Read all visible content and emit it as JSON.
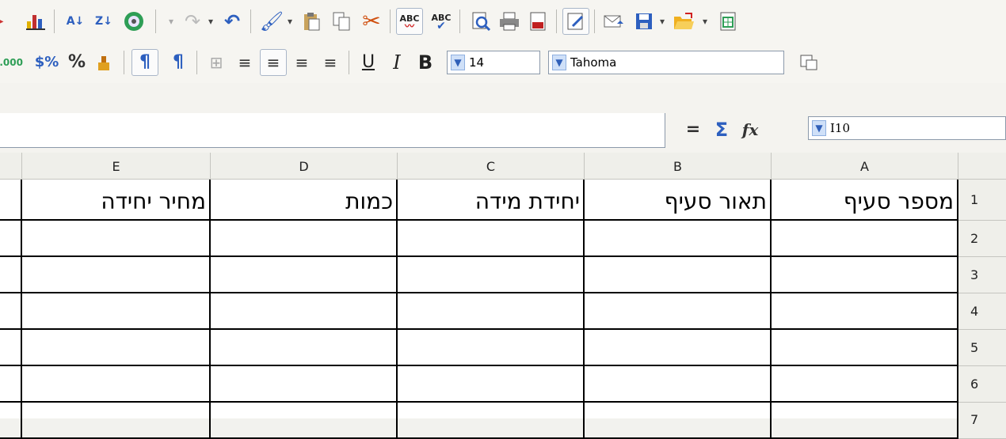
{
  "toolbar_standard": {
    "icons": [
      "chart-icon",
      "sort-ascending-icon",
      "sort-descending-icon",
      "navigator-icon",
      "redo-icon",
      "undo-icon",
      "format-paintbrush-icon",
      "paste-icon",
      "copy-icon",
      "cut-icon",
      "autospellcheck-icon",
      "spellcheck-icon",
      "print-preview-icon",
      "print-icon",
      "export-pdf-icon",
      "edit-file-icon",
      "email-icon",
      "save-icon",
      "open-icon",
      "new-icon"
    ]
  },
  "toolbar_formatting": {
    "font_size": "14",
    "font_name": "Tahoma",
    "bold_label": "B",
    "italic_label": "I",
    "underline_label": "U",
    "percent_label": "%"
  },
  "formula_bar": {
    "name_box": "I10",
    "equals_symbol": "=",
    "sum_symbol": "Σ",
    "function_symbol": "fx",
    "input_value": ""
  },
  "sheet": {
    "columns": [
      "A",
      "B",
      "C",
      "D",
      "E"
    ],
    "rows": [
      "1",
      "2",
      "3",
      "4",
      "5",
      "6",
      "7"
    ],
    "row1_values": [
      "מספר סעיף",
      "תאור סעיף",
      "יחידת מידה",
      "כמות",
      "מחיר יחידה"
    ]
  },
  "colors": {
    "toolbar_bg": "#f6f5f1",
    "header_bg": "#efefea",
    "grid_border": "#000000",
    "accent": "#2f5fb8"
  }
}
